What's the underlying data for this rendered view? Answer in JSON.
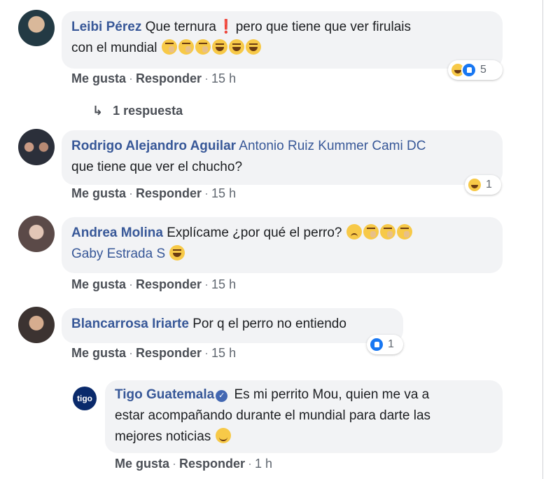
{
  "comments": [
    {
      "author": "Leibi Pérez",
      "text_a": "Que ternura",
      "text_b": "pero que tiene que ver firulais",
      "text_c": "con el mundial",
      "reaction_count": "5",
      "like_label": "Me gusta",
      "reply_label": "Responder",
      "time": "15 h",
      "replies_label": "1 respuesta"
    },
    {
      "author": "Rodrigo Alejandro Aguilar",
      "mention": "Antonio Ruiz Kummer Cami DC",
      "text": "que tiene que ver el chucho?",
      "reaction_count": "1",
      "like_label": "Me gusta",
      "reply_label": "Responder",
      "time": "15 h"
    },
    {
      "author": "Andrea Molina",
      "text": "Explícame ¿por qué el perro?",
      "mention": "Gaby Estrada S",
      "like_label": "Me gusta",
      "reply_label": "Responder",
      "time": "15 h"
    },
    {
      "author": "Blancarrosa Iriarte",
      "text": "Por q el perro no entiendo",
      "reaction_count": "1",
      "like_label": "Me gusta",
      "reply_label": "Responder",
      "time": "15 h"
    }
  ],
  "reply": {
    "logo_text": "tigo",
    "author": "Tigo Guatemala",
    "text_line1": "Es mi perrito Mou, quien me va a",
    "text_line2": "estar acompañando durante el mundial para darte las",
    "text_line3": "mejores noticias",
    "like_label": "Me gusta",
    "reply_label": "Responder",
    "time": "1 h"
  },
  "colors": {
    "author": "#385898",
    "bubble": "#f2f3f5",
    "like_blue": "#1877f2",
    "haha_yellow": "#f7c948"
  },
  "avatar_colors": [
    "#3a5560",
    "#2b2f3a",
    "#5b4a48",
    "#3c3331"
  ]
}
